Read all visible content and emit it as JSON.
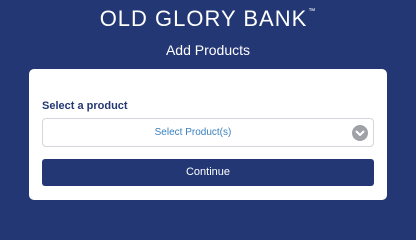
{
  "header": {
    "brand": "OLD GLORY BANK",
    "brand_mark": "™",
    "title": "Add Products"
  },
  "form": {
    "label": "Select a product",
    "select_value": "Select Product(s)",
    "select_icon": "chevron-down-circle-icon",
    "continue_label": "Continue"
  },
  "colors": {
    "background": "#233775",
    "accent": "#3a7fbf",
    "card": "#ffffff"
  }
}
